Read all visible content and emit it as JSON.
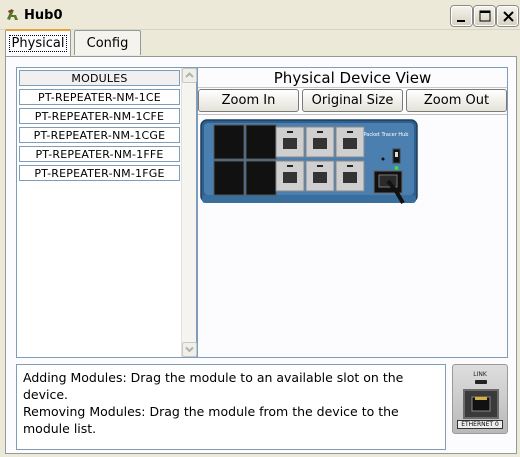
{
  "window": {
    "title": "Hub0",
    "icon": "cisco-bridge-icon",
    "controls": [
      "minimize-icon",
      "maximize-icon",
      "close-icon"
    ]
  },
  "tabs": [
    {
      "label": "Physical",
      "active": true
    },
    {
      "label": "Config",
      "active": false
    }
  ],
  "modules": {
    "header": "MODULES",
    "items": [
      "PT-REPEATER-NM-1CE",
      "PT-REPEATER-NM-1CFE",
      "PT-REPEATER-NM-1CGE",
      "PT-REPEATER-NM-1FFE",
      "PT-REPEATER-NM-1FGE"
    ]
  },
  "device_view": {
    "title": "Physical Device View",
    "buttons": {
      "zoom_in": "Zoom In",
      "original_size": "Original Size",
      "zoom_out": "Zoom Out"
    },
    "device_brand": "Packet Tracer Hub",
    "slots_empty": 4,
    "ports": 6
  },
  "info": {
    "line1": "Adding Modules: Drag the module to an available slot on the device.",
    "line2": "Removing Modules: Drag the module from the device to the module list."
  },
  "module_preview": {
    "link_label": "LINK",
    "port_label": "ETHERNET 0"
  },
  "colors": {
    "chassis": "#3a6e9c",
    "tab_accent": "#e8a23a",
    "panel_border": "#7f9db9"
  }
}
